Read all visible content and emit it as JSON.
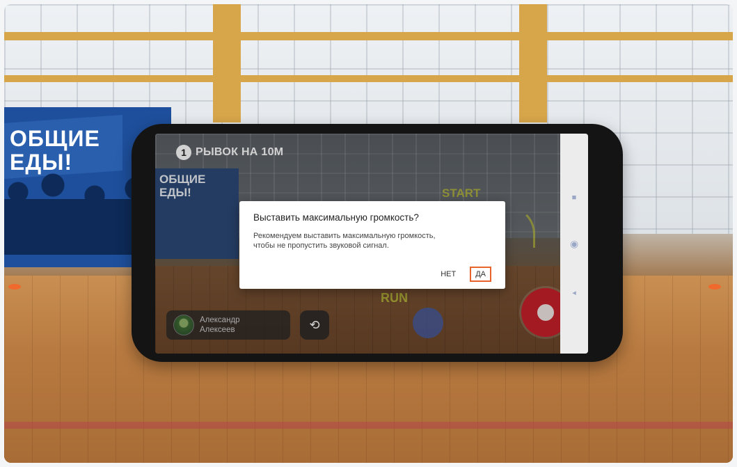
{
  "background": {
    "banner_text": "ОБЩИЕ\nЕДЫ!"
  },
  "phone": {
    "header": {
      "step_number": "1",
      "title": "РЫВОК НА 10М"
    },
    "scene": {
      "banner_text": "ОБЩИЕ\nЕДЫ!",
      "start_label": "START",
      "run_label": "RUN"
    },
    "athlete": {
      "name": "Александр\nАлексеев"
    },
    "dialog": {
      "title": "Выставить максимальную громкость?",
      "message": "Рекомендуем выставить максимальную громкость,\nчтобы не пропустить звуковой сигнал.",
      "no_label": "НЕТ",
      "yes_label": "ДА"
    },
    "nav": {
      "recent_icon": "■",
      "home_icon": "◉",
      "back_icon": "◂"
    },
    "colors": {
      "record_button": "#c8202a",
      "highlight": "#e8642a"
    }
  }
}
